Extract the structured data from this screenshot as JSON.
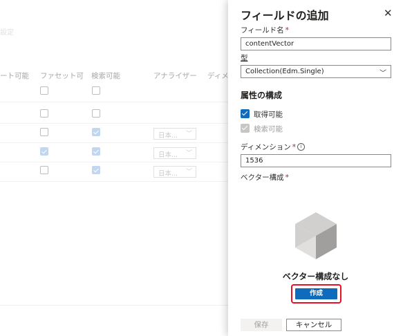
{
  "background": {
    "breadcrumb_fragment": "設定",
    "columns": [
      "ート可能",
      "ファセット可",
      "検索可能",
      "アナライザー",
      "ディメ"
    ],
    "rows": [
      {
        "facetable": false,
        "searchable": false,
        "analyzer": ""
      },
      {
        "facetable": false,
        "searchable": true,
        "analyzer": "日本..."
      },
      {
        "facetable": true,
        "searchable": true,
        "analyzer": "日本..."
      },
      {
        "facetable": false,
        "searchable": true,
        "analyzer": "日本..."
      }
    ]
  },
  "panel": {
    "title": "フィールドの追加",
    "close_icon": "close-icon",
    "field_name_label": "フィールド名",
    "field_name_value": "contentVector",
    "type_label": "型",
    "type_value": "Collection(Edm.Single)",
    "section_title": "属性の構成",
    "retrievable_label": "取得可能",
    "searchable_label": "検索可能",
    "dimensions_label": "ディメンション",
    "dimensions_value": "1536",
    "vector_profile_label": "ベクター構成",
    "empty_state_title": "ベクター構成なし",
    "create_button": "作成",
    "save_button": "保存",
    "cancel_button": "キャンセル",
    "required_mark": "*",
    "info_glyph": "i"
  },
  "colors": {
    "accent": "#0f6cbd",
    "highlight": "#e81123"
  }
}
